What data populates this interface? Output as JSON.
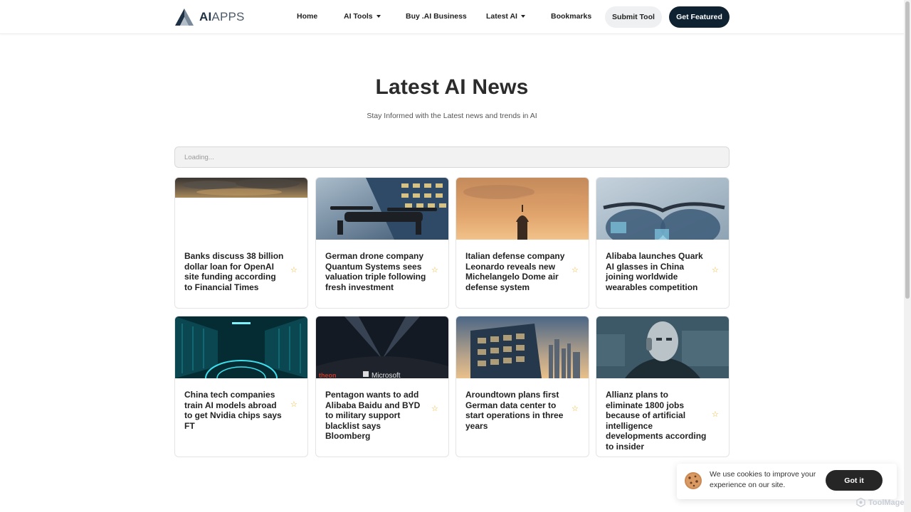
{
  "header": {
    "logo_bold": "AI",
    "logo_rest": "APPS",
    "nav": [
      {
        "label": "Home"
      },
      {
        "label": "AI Tools"
      },
      {
        "label": "Buy .AI Business"
      },
      {
        "label": "Latest AI"
      },
      {
        "label": "Bookmarks"
      }
    ],
    "submit_label": "Submit Tool",
    "featured_label": "Get Featured"
  },
  "hero": {
    "title": "Latest AI News",
    "subtitle": "Stay Informed with the Latest news and trends in AI"
  },
  "search": {
    "placeholder": "Loading..."
  },
  "news": [
    {
      "title": "Banks discuss 38 billion dollar loan for OpenAI site funding according to Financial Times",
      "image": "storm-clouds"
    },
    {
      "title": "German drone company Quantum Systems sees valuation triple following fresh investment",
      "image": "drone-office"
    },
    {
      "title": "Italian defense company Leonardo reveals new Michelangelo Dome air defense system",
      "image": "dome-sunset"
    },
    {
      "title": "Alibaba launches Quark AI glasses in China joining worldwide wearables competition",
      "image": "ai-glasses"
    },
    {
      "title": "China tech companies train AI models abroad to get Nvidia chips says FT",
      "image": "data-center"
    },
    {
      "title": "Pentagon wants to add Alibaba Baidu and BYD to military support blacklist says Bloomberg",
      "image": "microsoft-building",
      "image_text": "Microsoft",
      "image_text_2": "theon"
    },
    {
      "title": "Aroundtown plans first German data center to start operations in three years",
      "image": "glass-building-skyline"
    },
    {
      "title": "Allianz plans to eliminate 1800 jobs because of artificial intelligence developments according to insider",
      "image": "robot-office"
    }
  ],
  "cookie": {
    "text": "We use cookies to improve your experience on our site.",
    "button": "Got it"
  },
  "watermark": "ToolMage",
  "colors": {
    "primary_dark": "#0f2231",
    "star": "#f0b429",
    "cookie_button": "#262626"
  }
}
